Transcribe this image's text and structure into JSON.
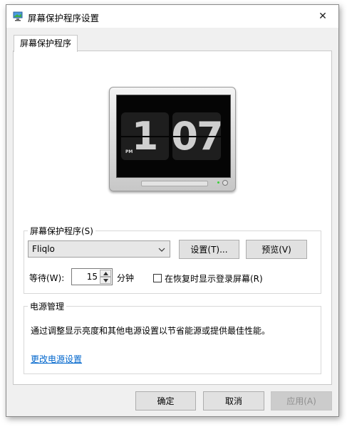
{
  "window": {
    "title": "屏幕保护程序设置",
    "close_glyph": "✕"
  },
  "tab": {
    "label": "屏幕保护程序"
  },
  "preview": {
    "hour": "1",
    "minutes": "07",
    "ampm": "PM"
  },
  "screensaver": {
    "group_label": "屏幕保护程序(S)",
    "selected": "Fliqlo",
    "settings_button": "设置(T)...",
    "preview_button": "预览(V)",
    "wait_label": "等待(W):",
    "wait_value": "15",
    "minutes_label": "分钟",
    "resume_checkbox_label": "在恢复时显示登录屏幕(R)",
    "resume_checked": false
  },
  "power": {
    "group_label": "电源管理",
    "description": "通过调整显示亮度和其他电源设置以节省能源或提供最佳性能。",
    "link": "更改电源设置"
  },
  "footer": {
    "ok": "确定",
    "cancel": "取消",
    "apply": "应用(A)"
  }
}
